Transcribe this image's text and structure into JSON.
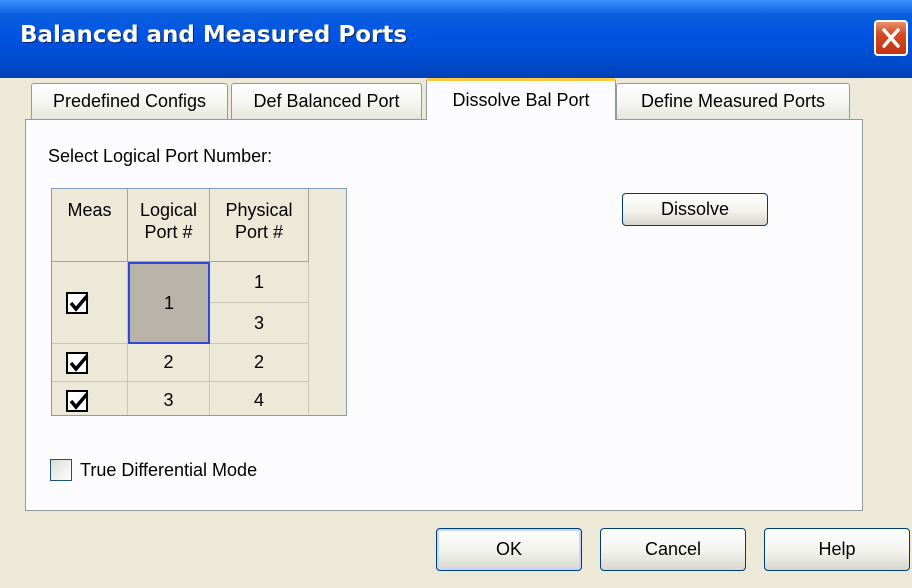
{
  "window": {
    "title": "Balanced and Measured Ports"
  },
  "tabs": [
    {
      "label": "Predefined Configs",
      "active": false
    },
    {
      "label": "Def Balanced Port",
      "active": false
    },
    {
      "label": "Dissolve Bal Port",
      "active": true
    },
    {
      "label": "Define Measured Ports",
      "active": false
    }
  ],
  "panel": {
    "select_label": "Select Logical Port Number:",
    "grid": {
      "headers": {
        "meas": "Meas",
        "logical": [
          "Logical",
          "Port #"
        ],
        "physical": [
          "Physical",
          "Port #"
        ]
      },
      "rows": [
        {
          "meas": true,
          "logical": "1",
          "physical": [
            "1",
            "3"
          ],
          "selected": true
        },
        {
          "meas": true,
          "logical": "2",
          "physical": [
            "2"
          ]
        },
        {
          "meas": true,
          "logical": "3",
          "physical": [
            "4"
          ]
        }
      ]
    },
    "dissolve_label": "Dissolve",
    "true_diff_label": "True Differential Mode",
    "true_diff_checked": false
  },
  "footer": {
    "ok_label": "OK",
    "cancel_label": "Cancel",
    "help_label": "Help"
  }
}
